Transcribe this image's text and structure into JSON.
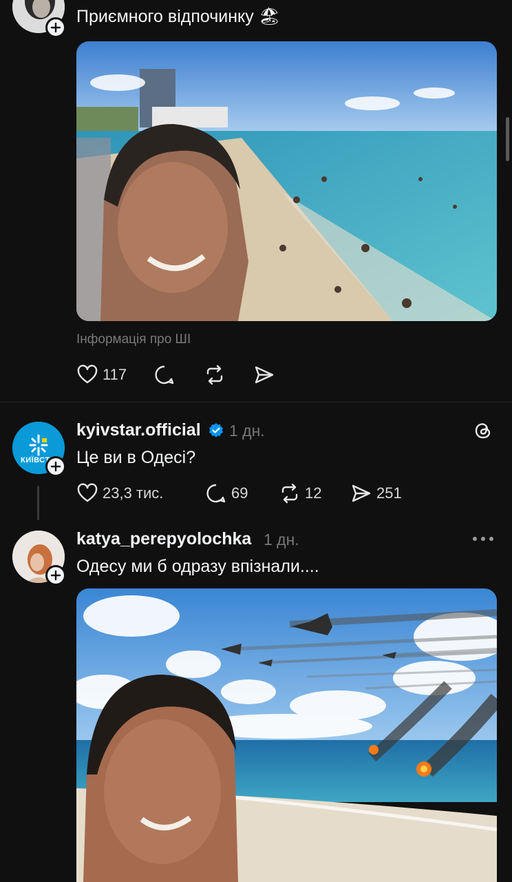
{
  "post1": {
    "text": "Приємного відпочинку 🏖",
    "ai_info": "Інформація про ШІ",
    "likes": "117"
  },
  "post2": {
    "username": "kyivstar.official",
    "time": "1 дн.",
    "text": "Це ви в Одесі?",
    "avatar_text": "КИЇВСТ",
    "likes": "23,3 тис.",
    "comments": "69",
    "reposts": "12",
    "shares": "251"
  },
  "post3": {
    "username": "katya_perepyolochka",
    "time": "1 дн.",
    "text": "Одесу ми б одразу впізнали...."
  },
  "colors": {
    "background": "#101010",
    "text": "#f3f5f7",
    "secondary": "#777777",
    "verified": "#0095f6",
    "kyivstar_blue": "#0a9ad8"
  }
}
